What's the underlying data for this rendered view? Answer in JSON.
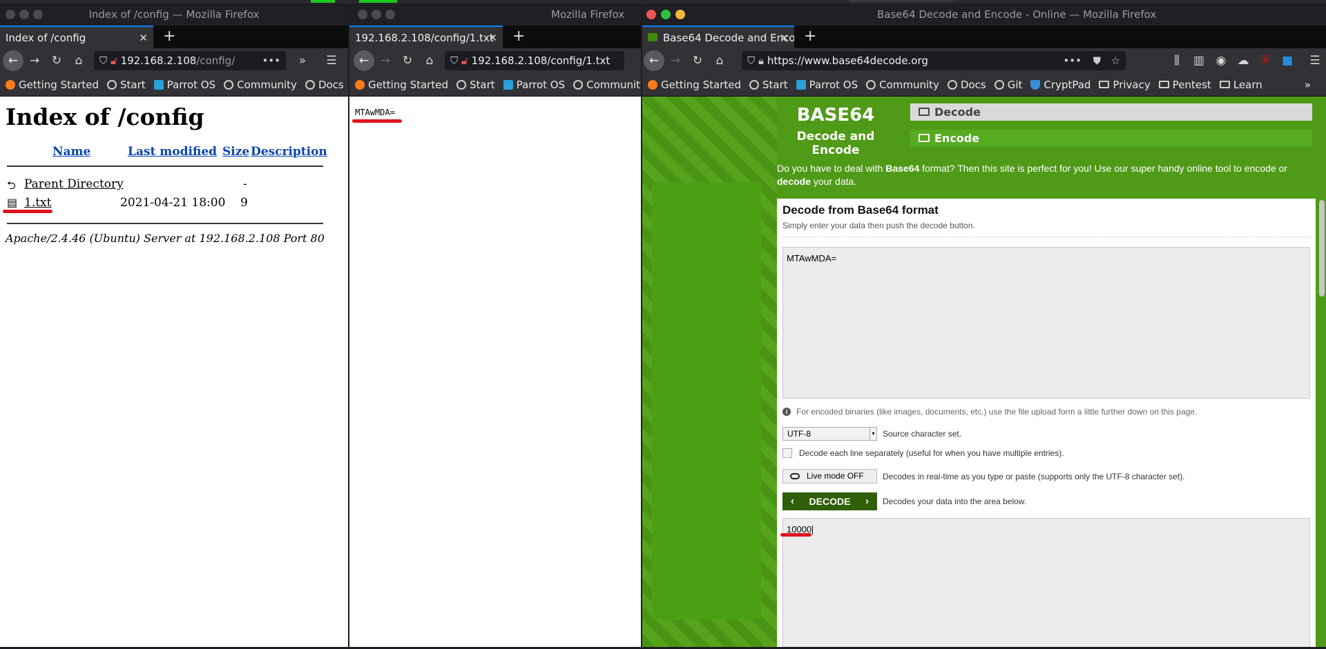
{
  "win1": {
    "title": "Index of /config — Mozilla Firefox",
    "tab_label": "Index of /config",
    "url_host": "192.168.2.108",
    "url_path": "/config/",
    "page_title": "Index of /config",
    "headers": [
      "Name",
      "Last modified",
      "Size",
      "Description"
    ],
    "rows": [
      {
        "name": "Parent Directory",
        "modified": "",
        "size": "-"
      },
      {
        "name": "1.txt",
        "modified": "2021-04-21 18:00",
        "size": "9"
      }
    ],
    "footer": "Apache/2.4.46 (Ubuntu) Server at 192.168.2.108 Port 80"
  },
  "win2": {
    "title": "Mozilla Firefox",
    "tab_label": "192.168.2.108/config/1.txt",
    "url": "192.168.2.108/config/1.txt",
    "body_text": "MTAwMDA="
  },
  "win3": {
    "title": "Base64 Decode and Encode - Online — Mozilla Firefox",
    "tab_label": "Base64 Decode and Enco",
    "url": "https://www.base64decode.org",
    "brand_title": "BASE64",
    "brand_sub": "Decode and Encode",
    "menu_decode": "Decode",
    "menu_encode": "Encode",
    "intro_1": "Do you have to deal with ",
    "intro_bold1": "Base64",
    "intro_2": " format? Then this site is perfect for you! Use our super handy online tool to encode or ",
    "intro_bold2": "decode",
    "intro_3": " your data.",
    "panel_title": "Decode from Base64 format",
    "panel_sub": "Simply enter your data then push the decode button.",
    "input_value": "MTAwMDA=",
    "info_text": "For encoded binaries (like images, documents, etc.) use the file upload form a little further down on this page.",
    "charset_value": "UTF-8",
    "charset_label": "Source character set.",
    "separate_label": "Decode each line separately (useful for when you have multiple entries).",
    "live_label": "Live mode OFF",
    "live_desc": "Decodes in real-time as you type or paste (supports only the UTF-8 character set).",
    "decode_btn": "DECODE",
    "decode_desc": "Decodes your data into the area below.",
    "output_value": "10000"
  },
  "bookmarks_short": [
    "Getting Started",
    "Start",
    "Parrot OS",
    "Community",
    "Docs"
  ],
  "bookmarks_long": [
    "Getting Started",
    "Start",
    "Parrot OS",
    "Community",
    "Docs",
    "Git",
    "CryptPad",
    "Privacy",
    "Pentest",
    "Learn"
  ],
  "colors": {
    "annotation": "#e0131e",
    "site_green": "#4f9a17",
    "decode_btn": "#2f5f08"
  }
}
